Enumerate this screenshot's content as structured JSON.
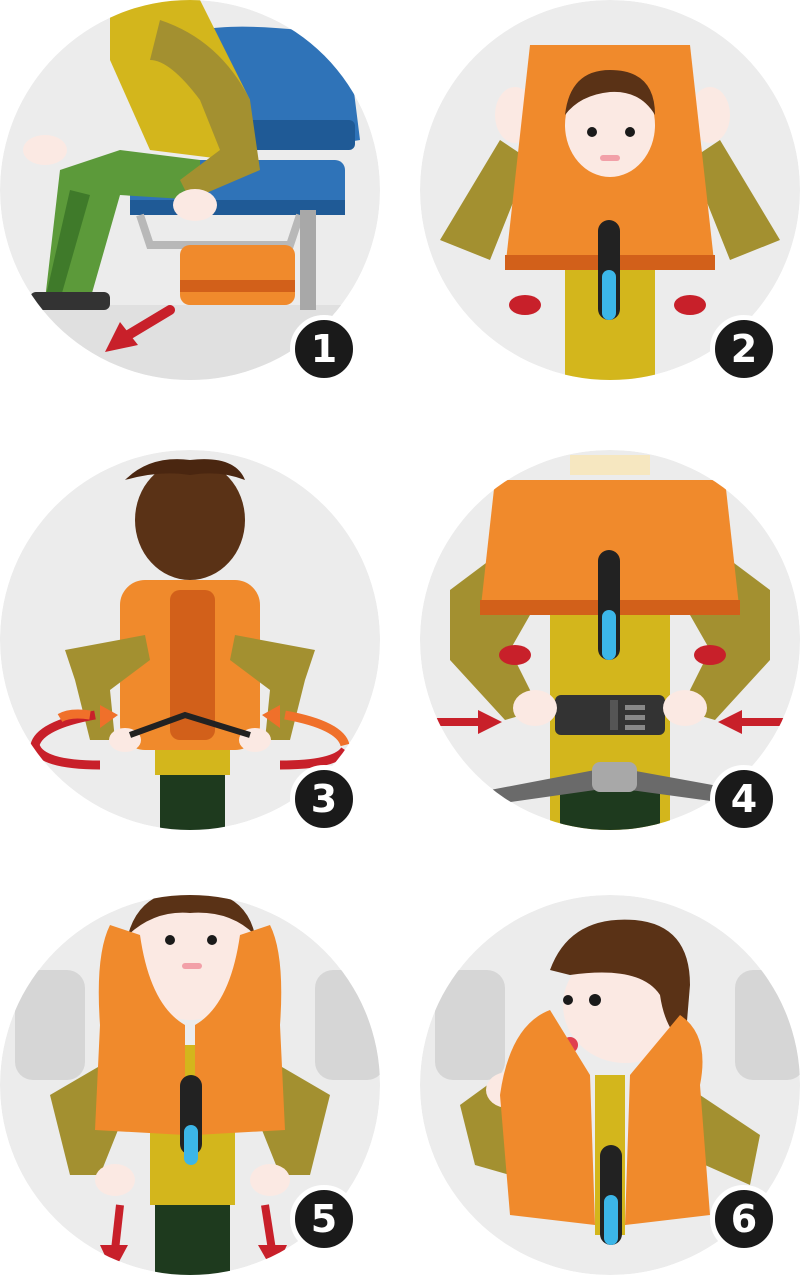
{
  "steps": [
    {
      "number": "1",
      "description": "retrieve-vest-from-under-seat"
    },
    {
      "number": "2",
      "description": "pull-vest-over-head"
    },
    {
      "number": "3",
      "description": "wrap-straps-around-waist"
    },
    {
      "number": "4",
      "description": "fasten-buckle"
    },
    {
      "number": "5",
      "description": "pull-tabs-to-inflate"
    },
    {
      "number": "6",
      "description": "blow-into-tube"
    }
  ],
  "colors": {
    "circle_bg": "#ececec",
    "vest_orange": "#f08a2c",
    "vest_dark": "#d2601a",
    "sleeve_olive": "#a39030",
    "shirt_yellow": "#d3b61c",
    "hair_brown": "#5a3216",
    "skin": "#fbe9e3",
    "seat_blue": "#2f73b8",
    "arrow_red": "#c8202a",
    "badge_black": "#1a1a1a",
    "tube_blue": "#3cb6e8"
  }
}
